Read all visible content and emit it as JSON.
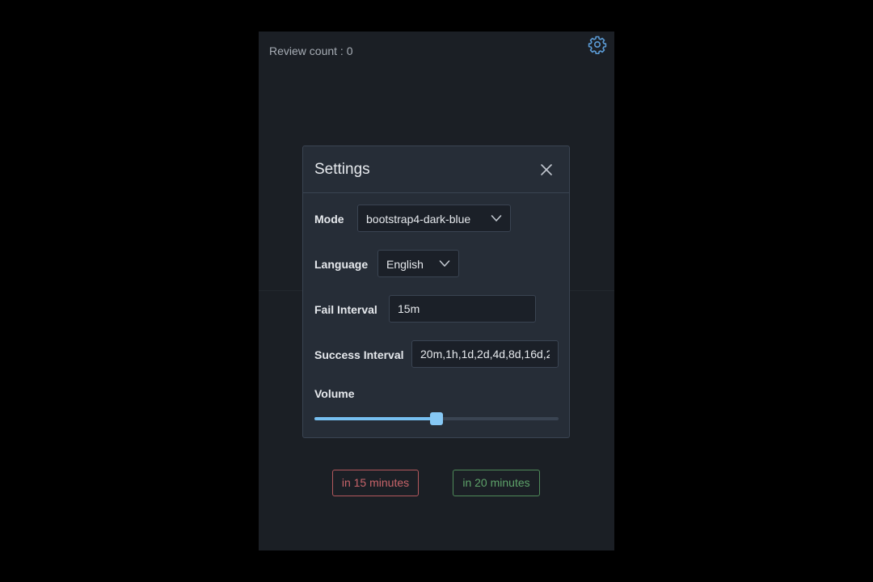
{
  "app": {
    "review_count_label": "Review count : 0"
  },
  "settings_modal": {
    "title": "Settings",
    "mode": {
      "label": "Mode",
      "value": "bootstrap4-dark-blue"
    },
    "language": {
      "label": "Language",
      "value": "English"
    },
    "fail_interval": {
      "label": "Fail Interval",
      "value": "15m"
    },
    "success_interval": {
      "label": "Success Interval",
      "value": "20m,1h,1d,2d,4d,8d,16d,2"
    },
    "volume": {
      "label": "Volume",
      "level": 0.5
    }
  },
  "answers": {
    "fail_label": "in 15 minutes",
    "success_label": "in 20 minutes"
  },
  "icons": {
    "settings": "gear-icon",
    "close": "close-icon",
    "dropdown": "chevron-down-icon"
  },
  "colors": {
    "accent": "#76bff0",
    "fail": "#c8646a",
    "success": "#5ea36a",
    "gear": "#5b9bd5"
  }
}
